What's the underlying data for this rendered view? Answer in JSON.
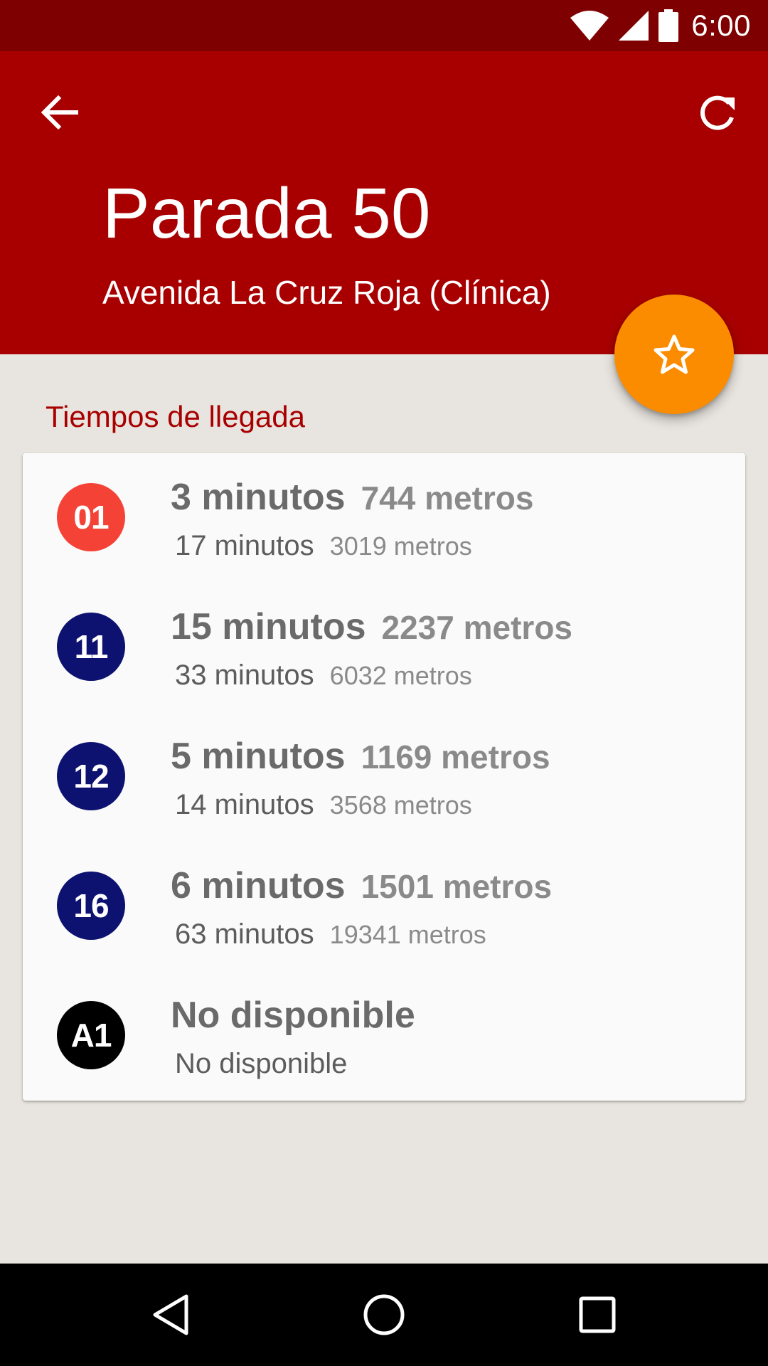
{
  "status_bar": {
    "time": "6:00",
    "icons": [
      "wifi-icon",
      "signal-icon",
      "battery-icon"
    ],
    "background": "#7f0000"
  },
  "app_bar": {
    "title": "Parada 50",
    "subtitle": "Avenida La Cruz Roja (Clínica)",
    "background": "#a80000",
    "back_icon": "arrow-back-icon",
    "refresh_icon": "refresh-icon"
  },
  "fab": {
    "icon": "star-outline-icon",
    "color": "#fb8c00"
  },
  "section": {
    "title": "Tiempos de llegada"
  },
  "arrivals": [
    {
      "line": "01",
      "color": "#f44336",
      "first_time": "3 minutos",
      "first_distance": "744 metros",
      "second_time": "17 minutos",
      "second_distance": "3019 metros"
    },
    {
      "line": "11",
      "color": "#0d1270",
      "first_time": "15 minutos",
      "first_distance": "2237 metros",
      "second_time": "33 minutos",
      "second_distance": "6032 metros"
    },
    {
      "line": "12",
      "color": "#0d1270",
      "first_time": "5 minutos",
      "first_distance": "1169 metros",
      "second_time": "14 minutos",
      "second_distance": "3568 metros"
    },
    {
      "line": "16",
      "color": "#0d1270",
      "first_time": "6 minutos",
      "first_distance": "1501 metros",
      "second_time": "63 minutos",
      "second_distance": "19341 metros"
    },
    {
      "line": "A1",
      "color": "#000000",
      "first_time": "No disponible",
      "first_distance": "",
      "second_time": "No disponible",
      "second_distance": ""
    }
  ],
  "nav_bar": {
    "icons": [
      "back-triangle-icon",
      "home-circle-icon",
      "recents-square-icon"
    ]
  }
}
